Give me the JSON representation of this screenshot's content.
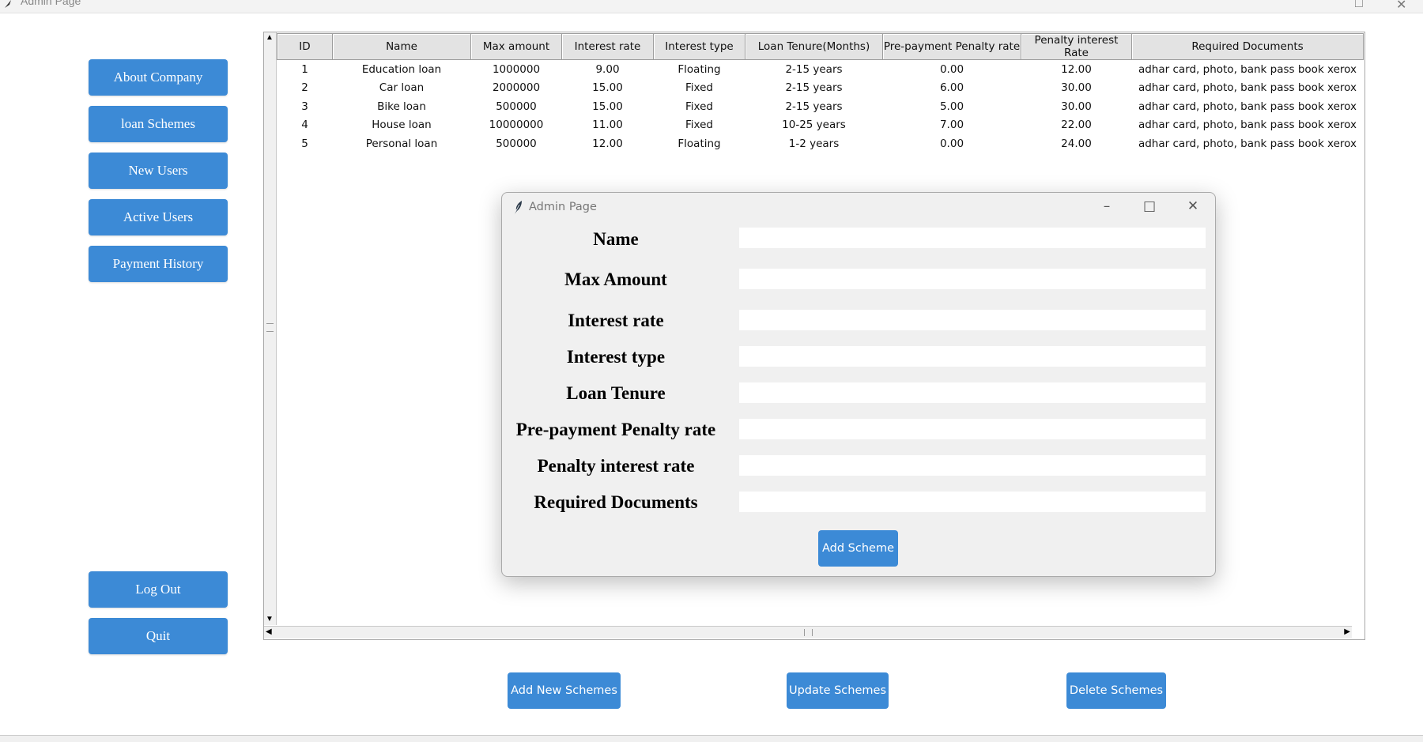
{
  "window": {
    "title": "Admin Page"
  },
  "sidebar": {
    "items": [
      {
        "label": "About Company"
      },
      {
        "label": "loan Schemes"
      },
      {
        "label": "New Users"
      },
      {
        "label": "Active Users"
      },
      {
        "label": "Payment History"
      }
    ],
    "logout_label": "Log Out",
    "quit_label": "Quit"
  },
  "table": {
    "columns": [
      "ID",
      "Name",
      "Max amount",
      "Interest rate",
      "Interest type",
      "Loan Tenure(Months)",
      "Pre-payment Penalty rate",
      "Penalty interest Rate",
      "Required Documents"
    ],
    "rows": [
      [
        "1",
        "Education loan",
        "1000000",
        "9.00",
        "Floating",
        "2-15 years",
        "0.00",
        "12.00",
        "adhar card, photo, bank pass book xerox"
      ],
      [
        "2",
        "Car loan",
        "2000000",
        "15.00",
        "Fixed",
        "2-15 years",
        "6.00",
        "30.00",
        "adhar card, photo, bank pass book xerox"
      ],
      [
        "3",
        "Bike loan",
        "500000",
        "15.00",
        "Fixed",
        "2-15 years",
        "5.00",
        "30.00",
        "adhar card, photo, bank pass book xerox"
      ],
      [
        "4",
        "House loan",
        "10000000",
        "11.00",
        "Fixed",
        "10-25 years",
        "7.00",
        "22.00",
        "adhar card, photo, bank pass book xerox"
      ],
      [
        "5",
        "Personal loan",
        "500000",
        "12.00",
        "Floating",
        "1-2 years",
        "0.00",
        "24.00",
        "adhar card, photo, bank pass book xerox"
      ]
    ]
  },
  "actions": {
    "add_label": "Add New Schemes",
    "update_label": "Update Schemes",
    "delete_label": "Delete Schemes"
  },
  "dialog": {
    "title": "Admin Page",
    "fields": [
      {
        "label": "Name",
        "value": ""
      },
      {
        "label": "Max Amount",
        "value": ""
      },
      {
        "label": "Interest rate",
        "value": ""
      },
      {
        "label": "Interest type",
        "value": ""
      },
      {
        "label": "Loan Tenure",
        "value": ""
      },
      {
        "label": "Pre-payment Penalty rate",
        "value": ""
      },
      {
        "label": "Penalty interest rate",
        "value": ""
      },
      {
        "label": "Required Documents",
        "value": ""
      }
    ],
    "submit_label": "Add Scheme"
  },
  "colors": {
    "accent": "#3c8ad6",
    "dialog_bg": "#f0f0f0",
    "header_bg": "#e3e3e3"
  },
  "icons": [
    "feather-icon",
    "minimize-icon",
    "maximize-icon",
    "close-icon"
  ]
}
